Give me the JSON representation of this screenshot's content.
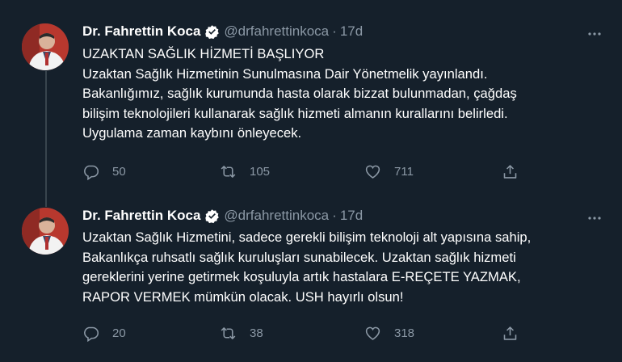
{
  "tweets": [
    {
      "author_name": "Dr. Fahrettin Koca",
      "handle": "@drfahrettinkoca",
      "separator": "·",
      "time": "17d",
      "lines": [
        "UZAKTAN SAĞLIK HİZMETİ BAŞLIYOR",
        "Uzaktan Sağlık Hizmetinin Sunulmasına Dair Yönetmelik yayınlandı.",
        "Bakanlığımız, sağlık kurumunda hasta olarak bizzat bulunmadan, çağdaş",
        "bilişim teknolojileri kullanarak sağlık hizmeti almanın kurallarını belirledi.",
        "Uygulama zaman kaybını önleyecek."
      ],
      "replies": "50",
      "retweets": "105",
      "likes": "711"
    },
    {
      "author_name": "Dr. Fahrettin Koca",
      "handle": "@drfahrettinkoca",
      "separator": "·",
      "time": "17d",
      "lines": [
        "Uzaktan Sağlık Hizmetini, sadece gerekli bilişim teknoloji alt yapısına sahip,",
        "Bakanlıkça ruhsatlı sağlık kuruluşları sunabilecek. Uzaktan sağlık hizmeti",
        "gereklerini yerine getirmek koşuluyla artık hastalara E-REÇETE YAZMAK,",
        "RAPOR VERMEK mümkün olacak. USH hayırlı olsun!"
      ],
      "replies": "20",
      "retweets": "38",
      "likes": "318"
    }
  ],
  "icons": {
    "verified": "verified-badge-icon",
    "more": "more-dots-icon",
    "reply": "reply-icon",
    "retweet": "retweet-icon",
    "like": "heart-icon",
    "share": "share-icon"
  },
  "colors": {
    "background": "#15202b",
    "text": "#ffffff",
    "secondary": "#8b98a5",
    "thread_line": "#38444d"
  }
}
